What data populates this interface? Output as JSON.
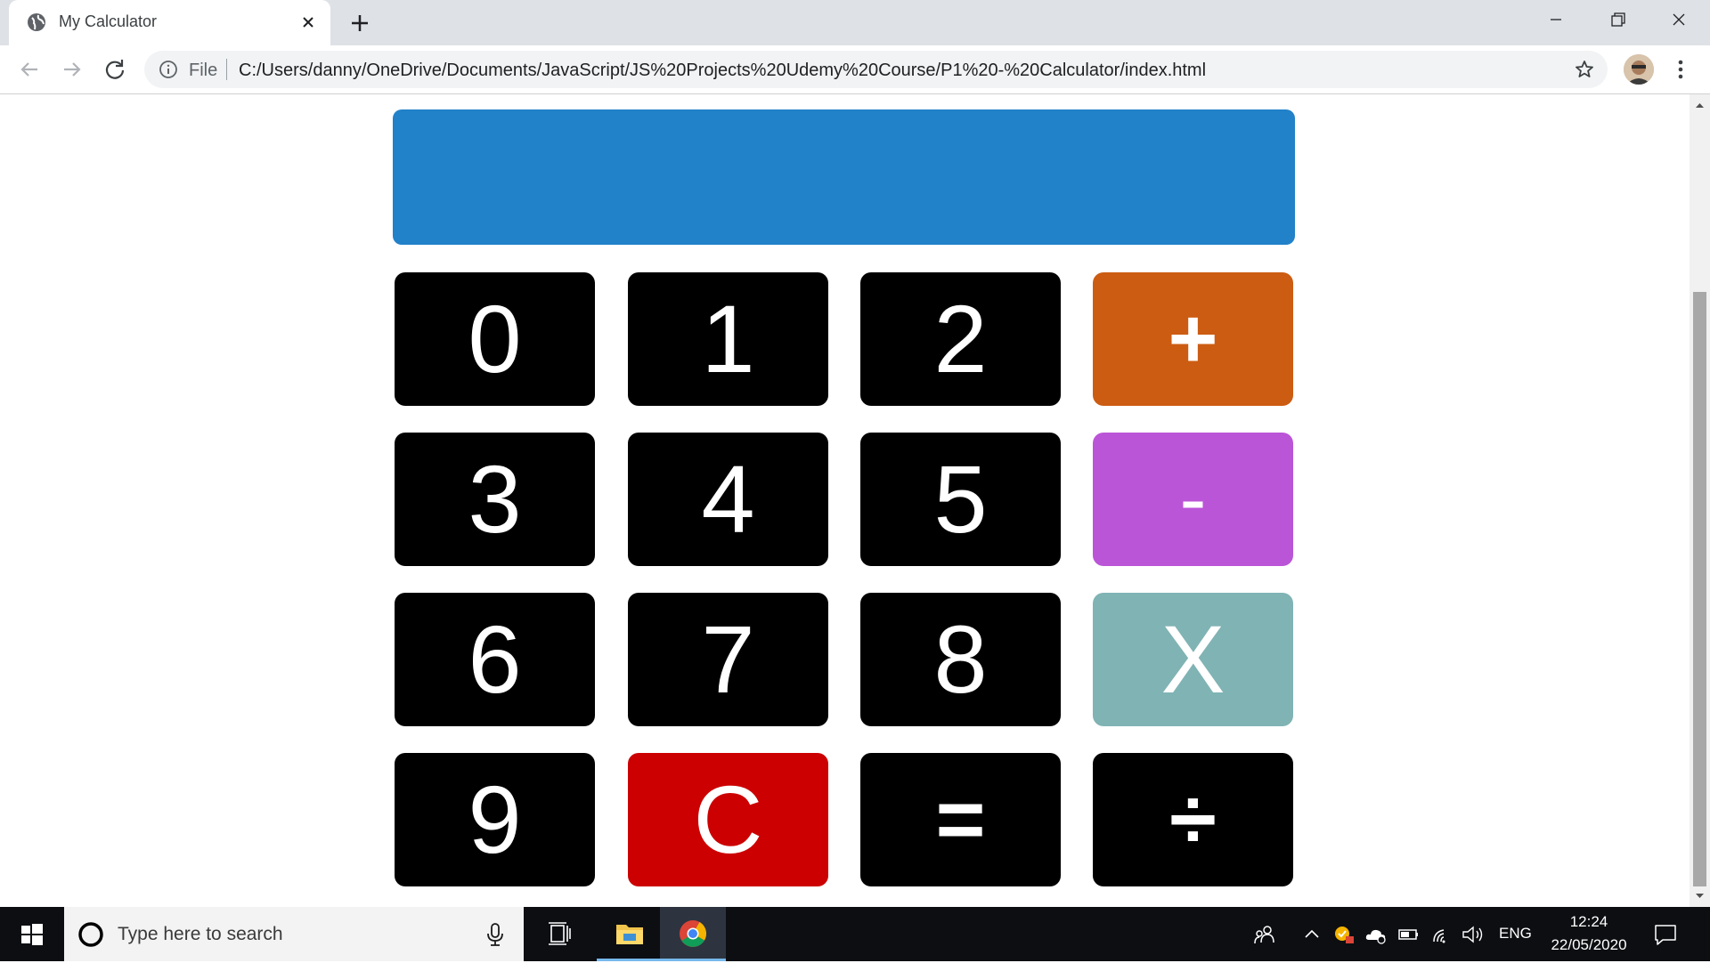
{
  "browser": {
    "tab_title": "My Calculator",
    "omnibox_scheme": "File",
    "url": "C:/Users/danny/OneDrive/Documents/JavaScript/JS%20Projects%20Udemy%20Course/P1%20-%20Calculator/index.html"
  },
  "calculator": {
    "display_value": "",
    "display_color": "#2181c9",
    "keys": [
      {
        "label": "0",
        "color": "#000000"
      },
      {
        "label": "1",
        "color": "#000000"
      },
      {
        "label": "2",
        "color": "#000000"
      },
      {
        "label": "+",
        "color": "#cc5c12"
      },
      {
        "label": "3",
        "color": "#000000"
      },
      {
        "label": "4",
        "color": "#000000"
      },
      {
        "label": "5",
        "color": "#000000"
      },
      {
        "label": "-",
        "color": "#bb55d7"
      },
      {
        "label": "6",
        "color": "#000000"
      },
      {
        "label": "7",
        "color": "#000000"
      },
      {
        "label": "8",
        "color": "#000000"
      },
      {
        "label": "X",
        "color": "#80b3b4"
      },
      {
        "label": "9",
        "color": "#000000"
      },
      {
        "label": "C",
        "color": "#cc0000"
      },
      {
        "label": "=",
        "color": "#000000"
      },
      {
        "label": "÷",
        "color": "#000000"
      }
    ]
  },
  "taskbar": {
    "search_placeholder": "Type here to search",
    "language": "ENG",
    "time": "12:24",
    "date": "22/05/2020"
  }
}
